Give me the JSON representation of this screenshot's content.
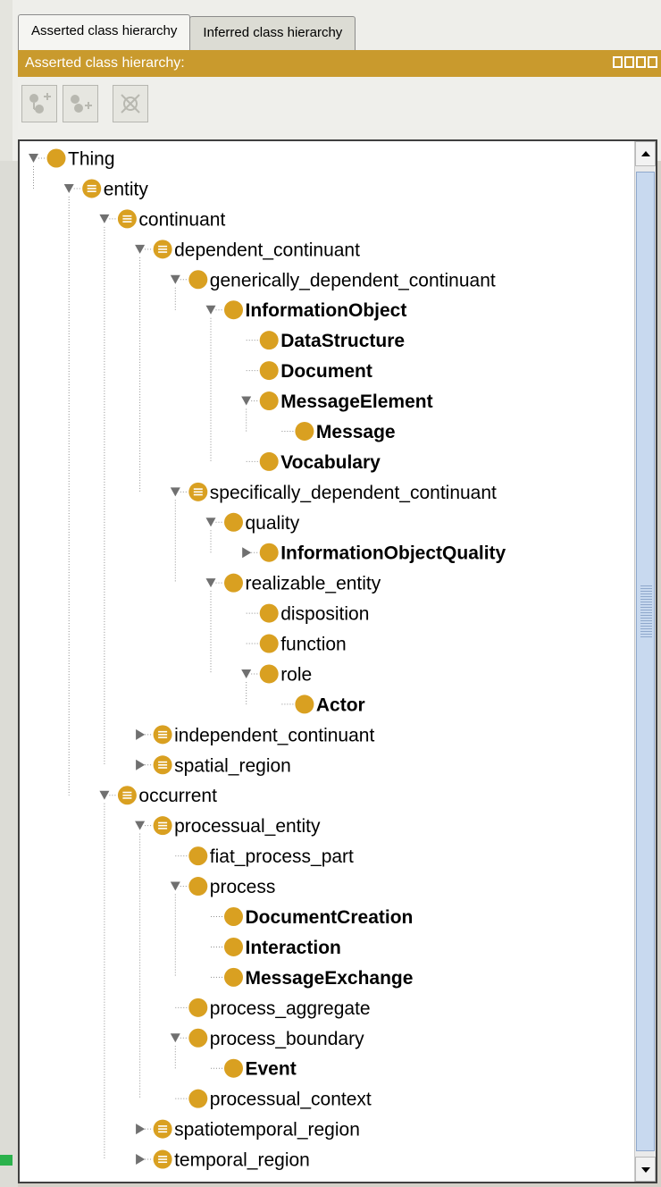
{
  "tabs": [
    {
      "label": "Asserted class hierarchy",
      "active": true
    },
    {
      "label": "Inferred class hierarchy",
      "active": false
    }
  ],
  "panel_title": "Asserted class hierarchy:",
  "colors": {
    "title_bar": "#c99a2d",
    "node_fill": "#d9a021"
  },
  "toolbar": {
    "buttons": [
      "add-subclass-icon",
      "add-sibling-icon",
      "delete-class-icon"
    ]
  },
  "tree": [
    {
      "label": "Thing",
      "level": 0,
      "expander": "open",
      "bold": false,
      "defined": false
    },
    {
      "label": "entity",
      "level": 1,
      "expander": "open",
      "bold": false,
      "defined": true
    },
    {
      "label": "continuant",
      "level": 2,
      "expander": "open",
      "bold": false,
      "defined": true
    },
    {
      "label": "dependent_continuant",
      "level": 3,
      "expander": "open",
      "bold": false,
      "defined": true
    },
    {
      "label": "generically_dependent_continuant",
      "level": 4,
      "expander": "open",
      "bold": false,
      "defined": false
    },
    {
      "label": "InformationObject",
      "level": 5,
      "expander": "open",
      "bold": true,
      "defined": false
    },
    {
      "label": "DataStructure",
      "level": 6,
      "expander": "none",
      "bold": true,
      "defined": false
    },
    {
      "label": "Document",
      "level": 6,
      "expander": "none",
      "bold": true,
      "defined": false
    },
    {
      "label": "MessageElement",
      "level": 6,
      "expander": "open",
      "bold": true,
      "defined": false
    },
    {
      "label": "Message",
      "level": 7,
      "expander": "none",
      "bold": true,
      "defined": false
    },
    {
      "label": "Vocabulary",
      "level": 6,
      "expander": "none",
      "bold": true,
      "defined": false
    },
    {
      "label": "specifically_dependent_continuant",
      "level": 4,
      "expander": "open",
      "bold": false,
      "defined": true
    },
    {
      "label": "quality",
      "level": 5,
      "expander": "open",
      "bold": false,
      "defined": false
    },
    {
      "label": "InformationObjectQuality",
      "level": 6,
      "expander": "closed",
      "bold": true,
      "defined": false
    },
    {
      "label": "realizable_entity",
      "level": 5,
      "expander": "open",
      "bold": false,
      "defined": false
    },
    {
      "label": "disposition",
      "level": 6,
      "expander": "none",
      "bold": false,
      "defined": false
    },
    {
      "label": "function",
      "level": 6,
      "expander": "none",
      "bold": false,
      "defined": false
    },
    {
      "label": "role",
      "level": 6,
      "expander": "open",
      "bold": false,
      "defined": false
    },
    {
      "label": "Actor",
      "level": 7,
      "expander": "none",
      "bold": true,
      "defined": false
    },
    {
      "label": "independent_continuant",
      "level": 3,
      "expander": "closed",
      "bold": false,
      "defined": true
    },
    {
      "label": "spatial_region",
      "level": 3,
      "expander": "closed",
      "bold": false,
      "defined": true
    },
    {
      "label": "occurrent",
      "level": 2,
      "expander": "open",
      "bold": false,
      "defined": true
    },
    {
      "label": "processual_entity",
      "level": 3,
      "expander": "open",
      "bold": false,
      "defined": true
    },
    {
      "label": "fiat_process_part",
      "level": 4,
      "expander": "none",
      "bold": false,
      "defined": false
    },
    {
      "label": "process",
      "level": 4,
      "expander": "open",
      "bold": false,
      "defined": false
    },
    {
      "label": "DocumentCreation",
      "level": 5,
      "expander": "none",
      "bold": true,
      "defined": false
    },
    {
      "label": "Interaction",
      "level": 5,
      "expander": "none",
      "bold": true,
      "defined": false
    },
    {
      "label": "MessageExchange",
      "level": 5,
      "expander": "none",
      "bold": true,
      "defined": false
    },
    {
      "label": "process_aggregate",
      "level": 4,
      "expander": "none",
      "bold": false,
      "defined": false
    },
    {
      "label": "process_boundary",
      "level": 4,
      "expander": "open",
      "bold": false,
      "defined": false
    },
    {
      "label": "Event",
      "level": 5,
      "expander": "none",
      "bold": true,
      "defined": false
    },
    {
      "label": "processual_context",
      "level": 4,
      "expander": "none",
      "bold": false,
      "defined": false
    },
    {
      "label": "spatiotemporal_region",
      "level": 3,
      "expander": "closed",
      "bold": false,
      "defined": true
    },
    {
      "label": "temporal_region",
      "level": 3,
      "expander": "closed",
      "bold": false,
      "defined": true
    }
  ]
}
